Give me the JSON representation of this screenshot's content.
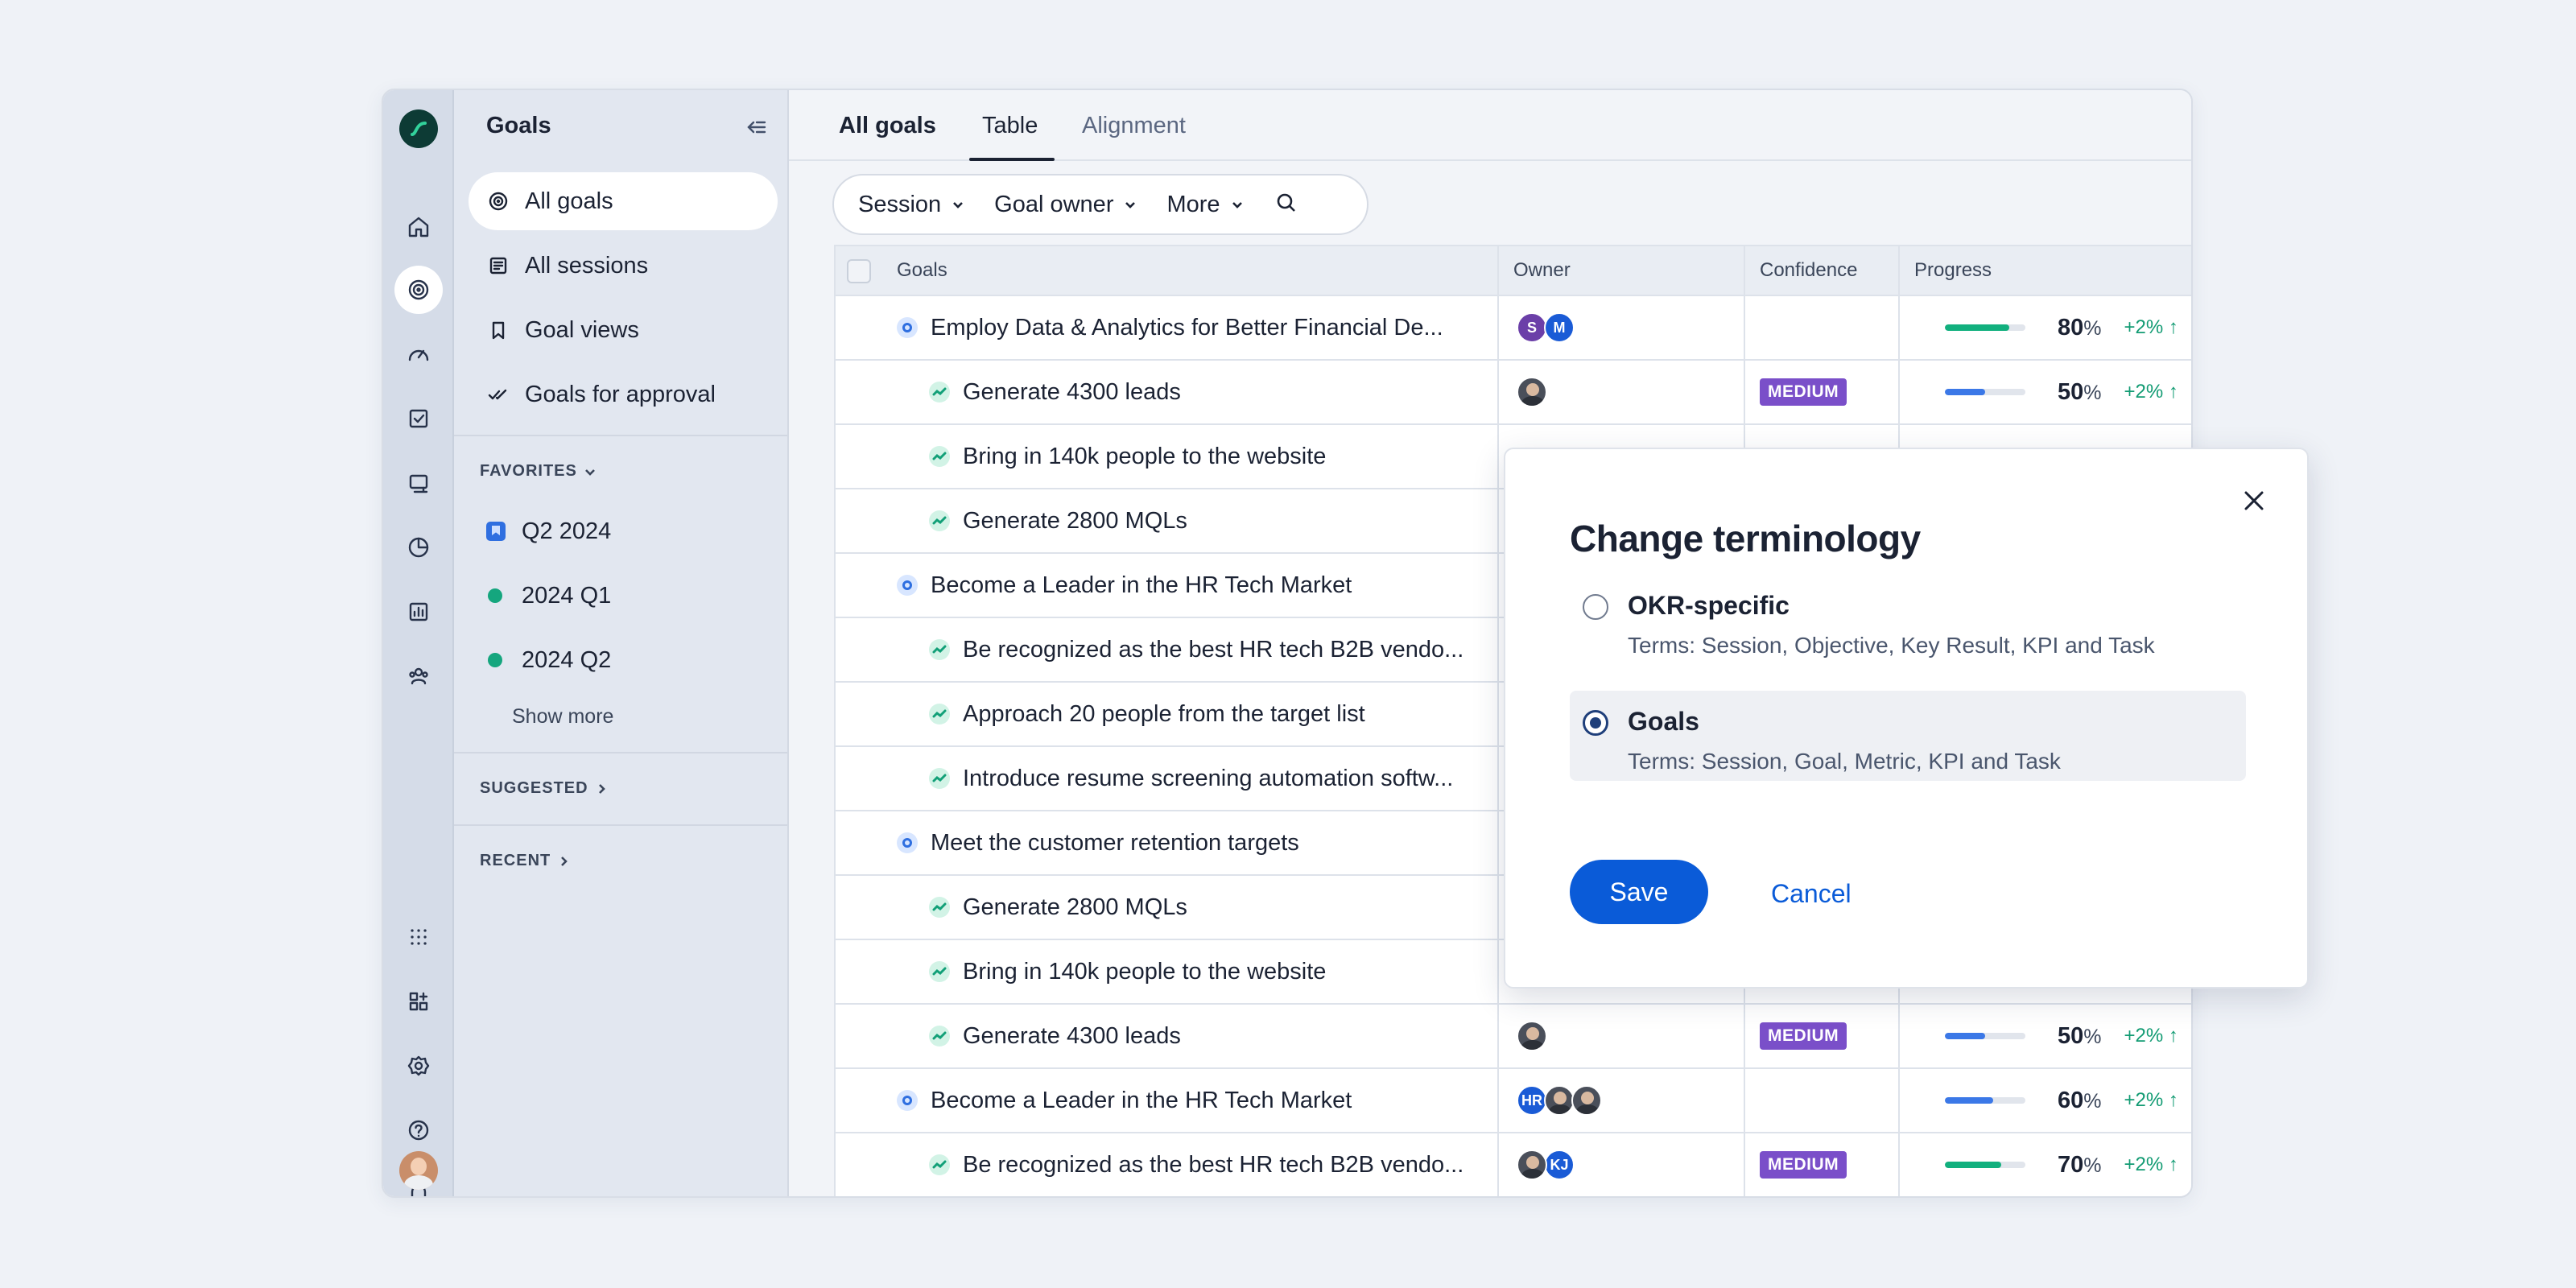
{
  "sidebar": {
    "title": "Goals",
    "items": [
      {
        "label": "All goals"
      },
      {
        "label": "All sessions"
      },
      {
        "label": "Goal views"
      },
      {
        "label": "Goals for approval"
      }
    ],
    "favorites_label": "FAVORITES",
    "favorites": [
      {
        "label": "Q2 2024",
        "icon": "bookmark-icon"
      },
      {
        "label": "2024 Q1",
        "color": "#15a67e"
      },
      {
        "label": "2024 Q2",
        "color": "#15a67e"
      }
    ],
    "show_more": "Show more",
    "suggested_label": "SUGGESTED",
    "recent_label": "RECENT"
  },
  "tabs": [
    {
      "label": "All goals"
    },
    {
      "label": "Table"
    },
    {
      "label": "Alignment"
    }
  ],
  "filters": {
    "session": "Session",
    "goal_owner": "Goal owner",
    "more": "More"
  },
  "table": {
    "columns": [
      "Goals",
      "Owner",
      "Confidence",
      "Progress"
    ],
    "rows": [
      {
        "type": "goal",
        "name": "Employ Data & Analytics for Better Financial De...",
        "owners": [
          "S",
          "M"
        ],
        "confidence": "",
        "progress": 80,
        "delta": "+2%",
        "bar_color": "#12b07e"
      },
      {
        "type": "kr",
        "name": "Generate 4300 leads",
        "owners": [
          "photo"
        ],
        "confidence": "MEDIUM",
        "progress": 50,
        "delta": "+2%",
        "bar_color": "#3b78e7"
      },
      {
        "type": "kr",
        "name": "Bring in 140k people to the website"
      },
      {
        "type": "kr",
        "name": "Generate 2800 MQLs"
      },
      {
        "type": "goal",
        "name": "Become a Leader in the HR Tech Market"
      },
      {
        "type": "kr",
        "name": "Be recognized as the best HR tech B2B vendo..."
      },
      {
        "type": "kr",
        "name": "Approach 20 people from the target list"
      },
      {
        "type": "kr",
        "name": "Introduce resume screening automation softw..."
      },
      {
        "type": "goal",
        "name": "Meet the customer retention targets"
      },
      {
        "type": "kr",
        "name": "Generate 2800 MQLs"
      },
      {
        "type": "kr",
        "name": "Bring in 140k people to the website"
      },
      {
        "type": "kr",
        "name": "Generate 4300 leads",
        "owners": [
          "photo"
        ],
        "confidence": "MEDIUM",
        "progress": 50,
        "delta": "+2%",
        "bar_color": "#3b78e7"
      },
      {
        "type": "goal",
        "name": "Become a Leader in the HR Tech Market",
        "owners": [
          "HR",
          "photo",
          "photo"
        ],
        "confidence": "",
        "progress": 60,
        "delta": "+2%",
        "bar_color": "#3b78e7"
      },
      {
        "type": "kr",
        "name": "Be recognized as the best HR tech B2B vendo...",
        "owners": [
          "photo",
          "KJ"
        ],
        "confidence": "MEDIUM",
        "progress": 70,
        "delta": "+2%",
        "bar_color": "#12b07e"
      }
    ]
  },
  "modal": {
    "title": "Change terminology",
    "options": [
      {
        "name": "OKR-specific",
        "desc": "Terms: Session, Objective, Key Result, KPI and Task",
        "selected": false
      },
      {
        "name": "Goals",
        "desc": "Terms: Session, Goal, Metric, KPI and Task",
        "selected": true
      }
    ],
    "save": "Save",
    "cancel": "Cancel"
  }
}
